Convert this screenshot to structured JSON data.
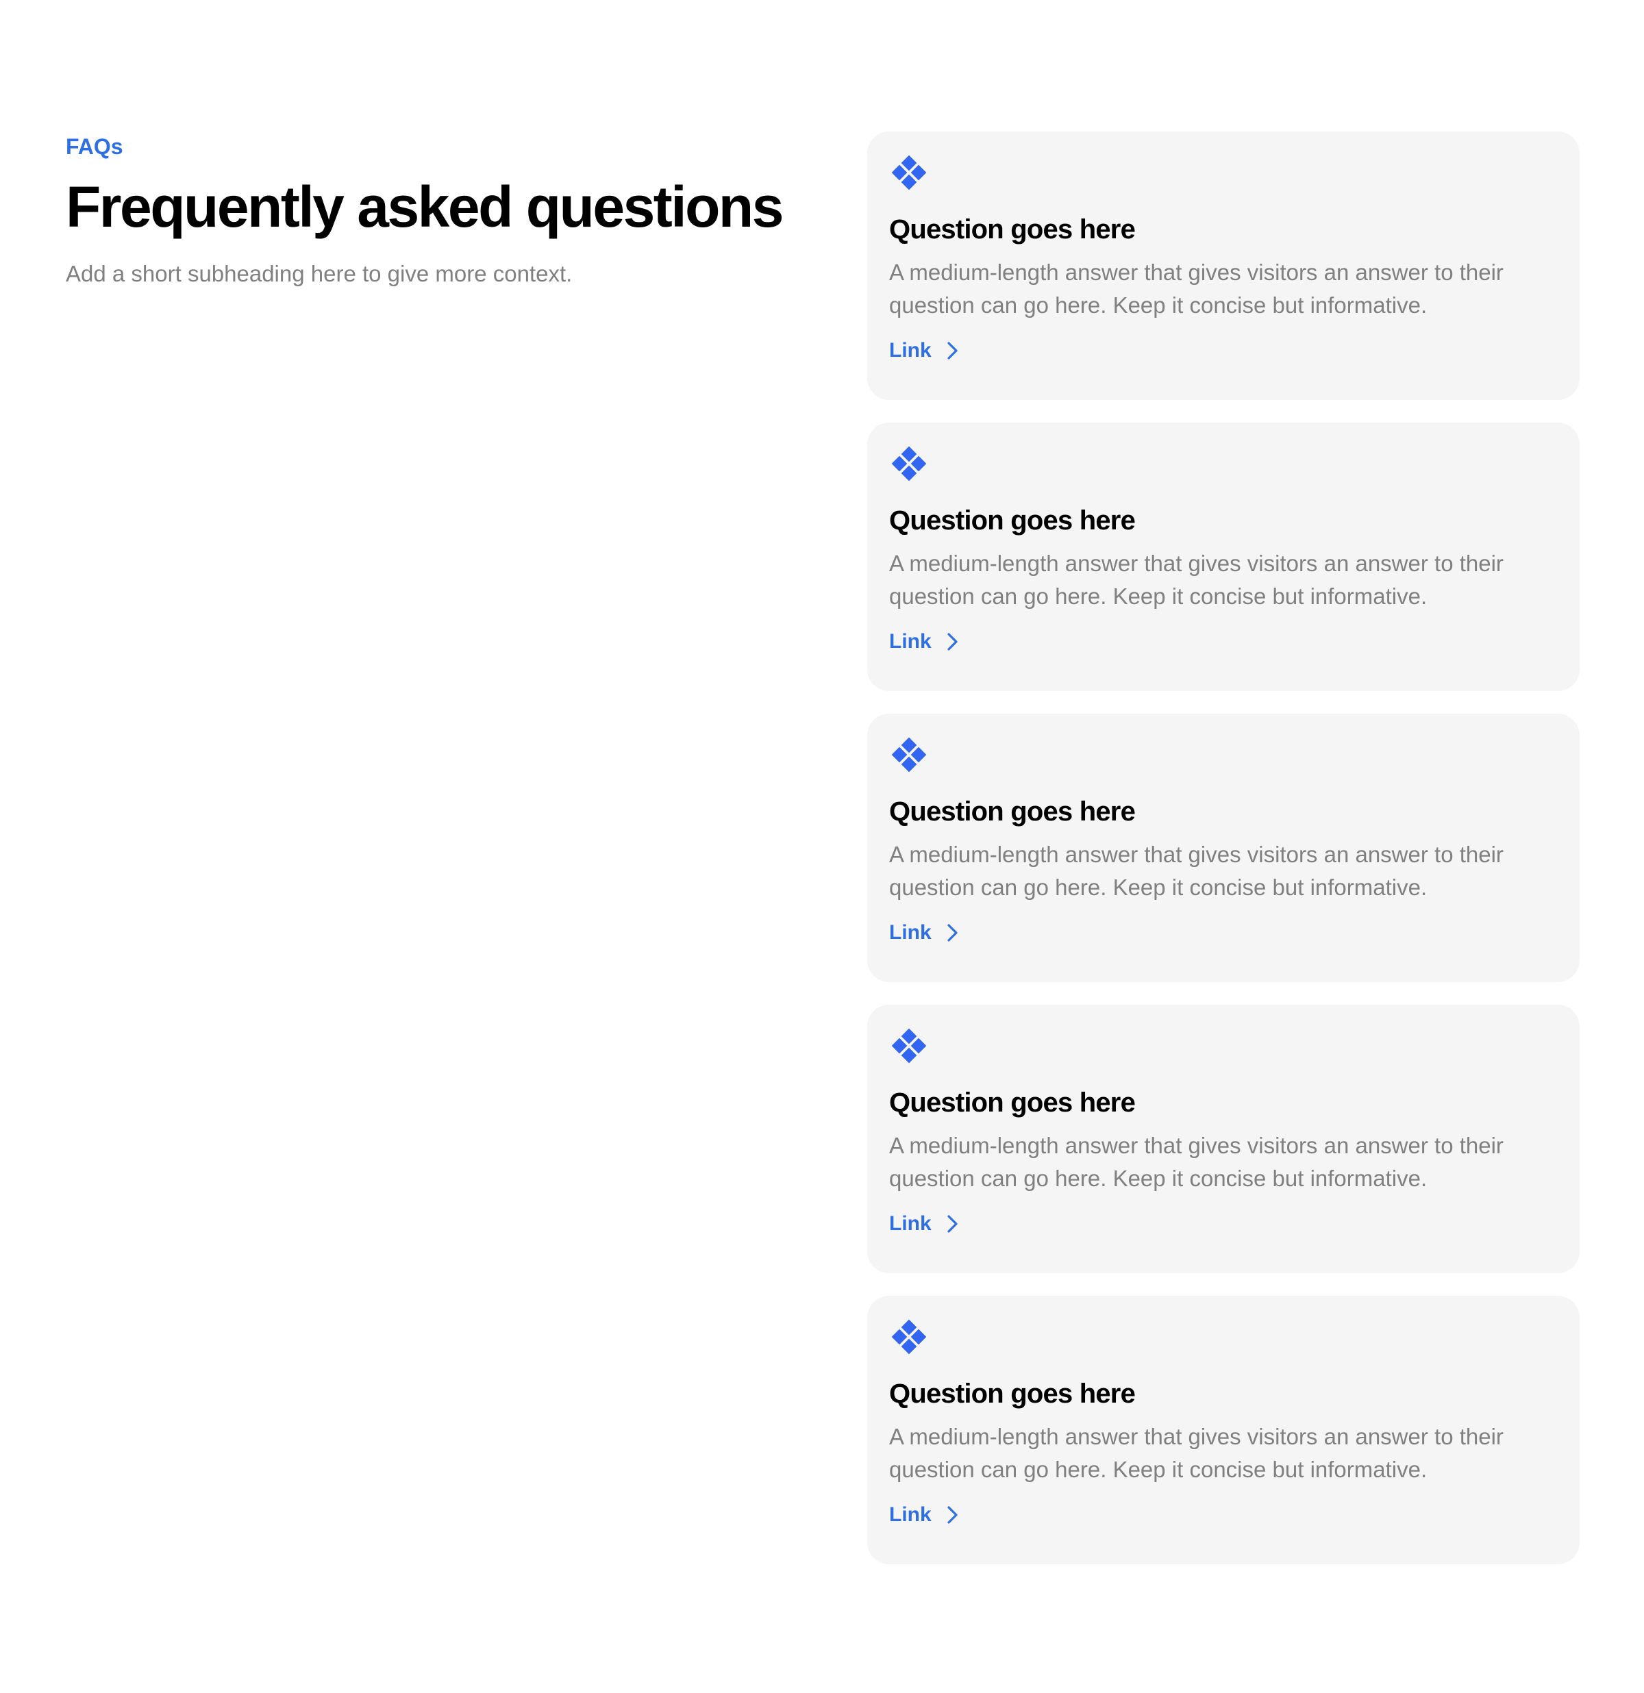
{
  "theme": {
    "accent": "#2F6FE4",
    "icon_blue": "#3366F0",
    "heading": "#000000",
    "muted_text": "#808080",
    "card_background": "#F5F5F5",
    "page_background": "#FFFFFF"
  },
  "intro": {
    "eyebrow": "FAQs",
    "title": "Frequently asked questions",
    "subheading": "Add a short subheading here to give more context."
  },
  "faqs": [
    {
      "icon": "diamond-cluster-icon",
      "question": "Question goes here",
      "answer": "A medium-length answer that gives visitors an answer to their question can go here. Keep it concise but informative.",
      "link_label": "Link"
    },
    {
      "icon": "diamond-cluster-icon",
      "question": "Question goes here",
      "answer": "A medium-length answer that gives visitors an answer to their question can go here. Keep it concise but informative.",
      "link_label": "Link"
    },
    {
      "icon": "diamond-cluster-icon",
      "question": "Question goes here",
      "answer": "A medium-length answer that gives visitors an answer to their question can go here. Keep it concise but informative.",
      "link_label": "Link"
    },
    {
      "icon": "diamond-cluster-icon",
      "question": "Question goes here",
      "answer": "A medium-length answer that gives visitors an answer to their question can go here. Keep it concise but informative.",
      "link_label": "Link"
    },
    {
      "icon": "diamond-cluster-icon",
      "question": "Question goes here",
      "answer": "A medium-length answer that gives visitors an answer to their question can go here. Keep it concise but informative.",
      "link_label": "Link"
    }
  ]
}
